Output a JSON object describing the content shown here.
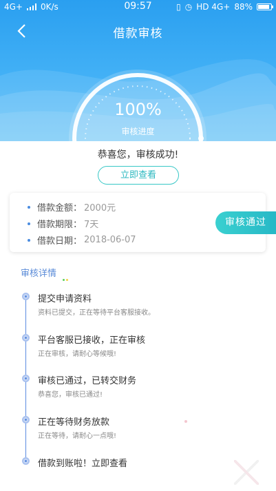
{
  "status_bar": {
    "network_left": "4G+",
    "speed": "0K/s",
    "time": "09:57",
    "network_right": "HD 4G+",
    "battery": "88%"
  },
  "nav": {
    "title": "借款审核"
  },
  "gauge": {
    "percent": "100%",
    "label": "审核进度",
    "progress": 1.0
  },
  "result": {
    "message": "恭喜您，审核成功!",
    "view_button": "立即查看"
  },
  "loan_info": {
    "rows": [
      {
        "label": "借款金额：",
        "value": "2000元"
      },
      {
        "label": "借款期限：",
        "value": "7天"
      },
      {
        "label": "借款日期：",
        "value": "2018-06-07"
      }
    ],
    "status_button": "审核通过"
  },
  "details": {
    "title": "审核详情",
    "steps": [
      {
        "title": "提交申请资料",
        "desc": "资料已提交，正在等待平台客服接收。"
      },
      {
        "title": "平台客服已接收，正在审核",
        "desc": "正在审核，请耐心等候哦!"
      },
      {
        "title": "审核已通过，已转交财务",
        "desc": "恭喜您，审核已通过!"
      },
      {
        "title": "正在等待财务放款",
        "desc": "正在等待，请耐心一点哦!"
      },
      {
        "title": "借款到账啦！立即查看",
        "desc": ""
      }
    ]
  },
  "colors": {
    "header": "#2a9ff0",
    "accent": "#36c7c6",
    "link_blue": "#5a8bd8"
  }
}
